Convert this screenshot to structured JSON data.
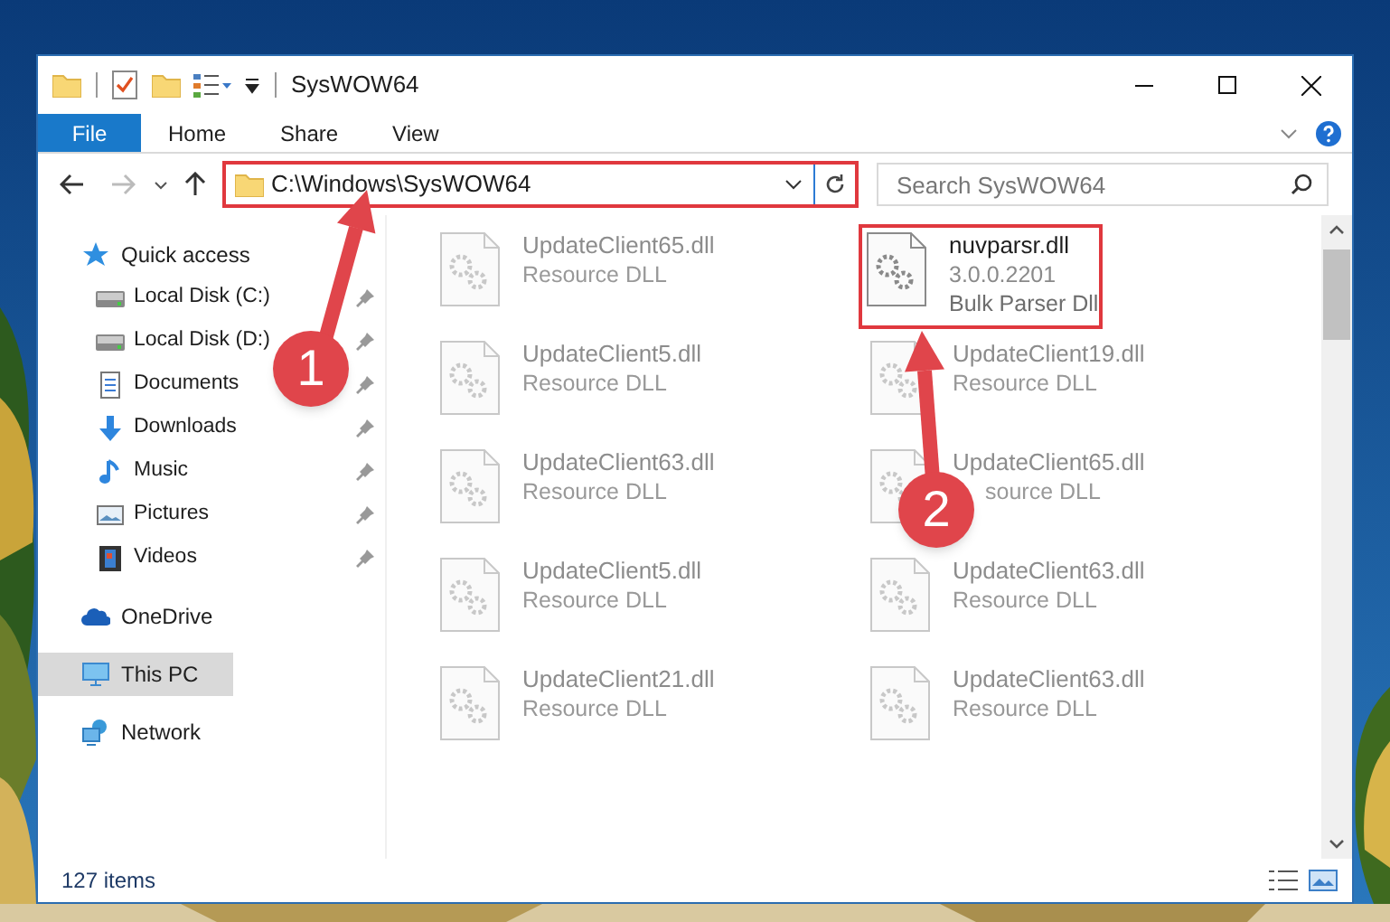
{
  "window": {
    "title": "SysWOW64"
  },
  "ribbon_tabs": [
    {
      "label": "File",
      "kind": "file"
    },
    {
      "label": "Home",
      "kind": "tab"
    },
    {
      "label": "Share",
      "kind": "tab"
    },
    {
      "label": "View",
      "kind": "tab"
    }
  ],
  "address_bar": {
    "path": "C:\\Windows\\SysWOW64",
    "highlighted": true
  },
  "search": {
    "placeholder": "Search SysWOW64"
  },
  "navigation": [
    {
      "label": "Quick access",
      "kind": "star",
      "selected": false,
      "children": [
        {
          "label": "Local Disk (C:)",
          "kind": "drive",
          "pinned": true
        },
        {
          "label": "Local Disk (D:)",
          "kind": "drive",
          "pinned": true
        },
        {
          "label": "Documents",
          "kind": "document",
          "pinned": true
        },
        {
          "label": "Downloads",
          "kind": "download",
          "pinned": true
        },
        {
          "label": "Music",
          "kind": "music",
          "pinned": true
        },
        {
          "label": "Pictures",
          "kind": "pictures",
          "pinned": true
        },
        {
          "label": "Videos",
          "kind": "videos",
          "pinned": true
        }
      ]
    },
    {
      "label": "OneDrive",
      "kind": "cloud",
      "selected": false
    },
    {
      "label": "This PC",
      "kind": "pc",
      "selected": true
    },
    {
      "label": "Network",
      "kind": "network",
      "selected": false
    }
  ],
  "files": [
    {
      "name": "UpdateClient65.dll",
      "description": "Resource DLL",
      "blurred": true,
      "highlighted": false
    },
    {
      "name": "nuvparsr.dll",
      "version": "3.0.0.2201",
      "description": "Bulk Parser Dll",
      "blurred": false,
      "highlighted": true
    },
    {
      "name": "UpdateClient5.dll",
      "description": "Resource DLL",
      "blurred": true,
      "highlighted": false
    },
    {
      "name": "UpdateClient19.dll",
      "description": "Resource DLL",
      "blurred": true,
      "highlighted": false
    },
    {
      "name": "UpdateClient63.dll",
      "description": "Resource DLL",
      "blurred": true,
      "highlighted": false
    },
    {
      "name": "UpdateClient65.dll",
      "description": "source DLL",
      "blurred": true,
      "highlighted": false,
      "description_covered": true
    },
    {
      "name": "UpdateClient5.dll",
      "description": "Resource DLL",
      "blurred": true,
      "highlighted": false
    },
    {
      "name": "UpdateClient63.dll",
      "description": "Resource DLL",
      "blurred": true,
      "highlighted": false
    },
    {
      "name": "UpdateClient21.dll",
      "description": "Resource DLL",
      "blurred": true,
      "highlighted": false
    },
    {
      "name": "UpdateClient63.dll",
      "description": "Resource DLL",
      "blurred": true,
      "highlighted": false
    }
  ],
  "status_bar": {
    "item_count": "127 items"
  },
  "annotations": [
    {
      "label": "1"
    },
    {
      "label": "2"
    }
  ]
}
